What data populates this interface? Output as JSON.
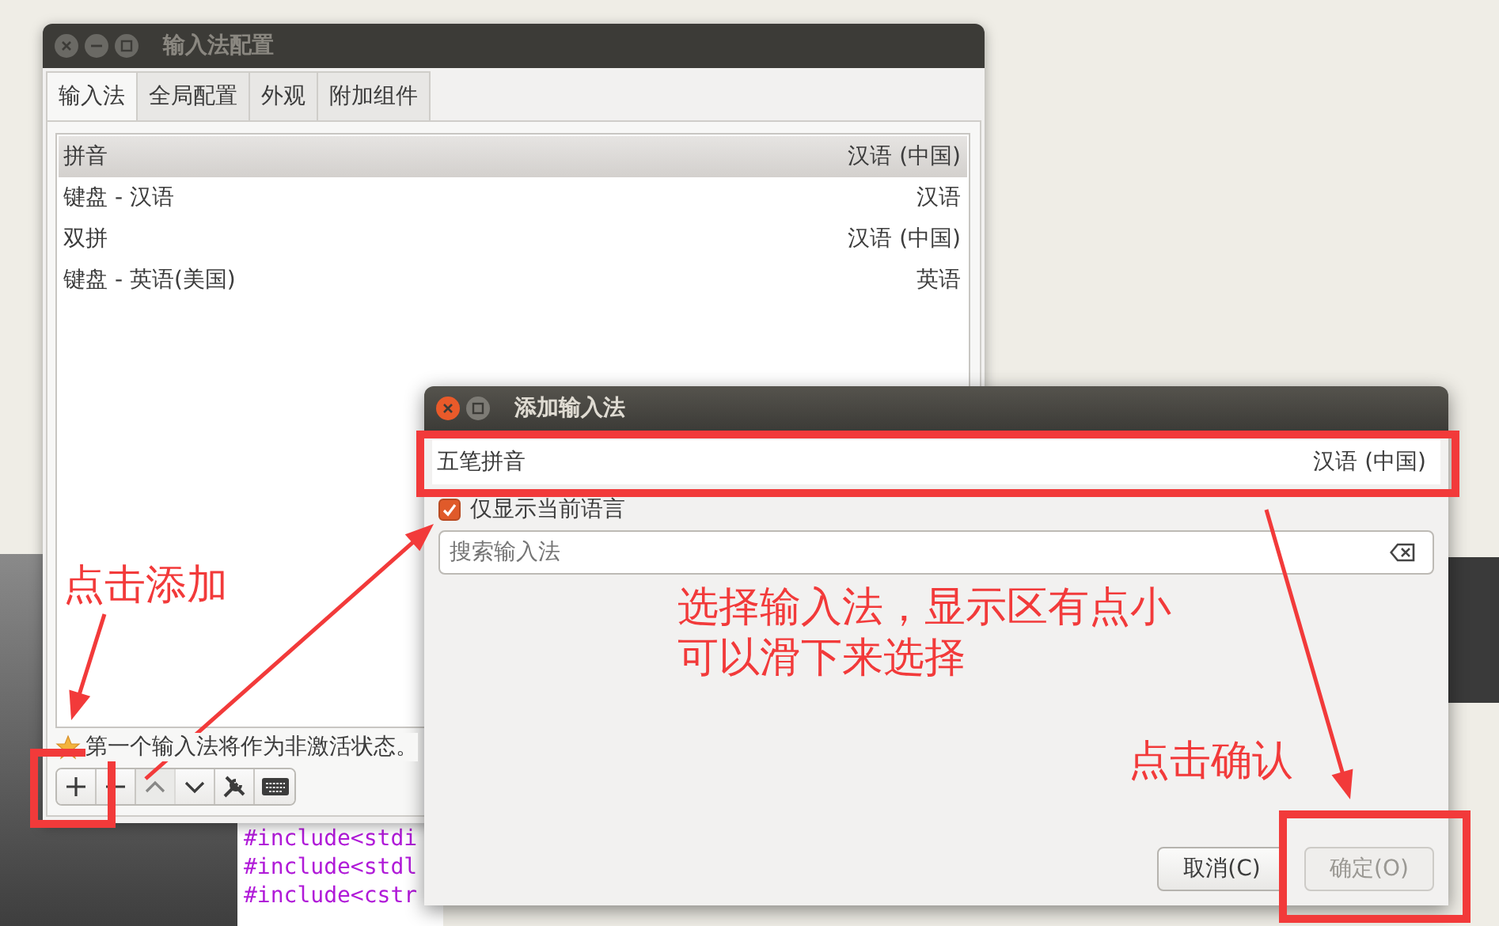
{
  "desktop": {
    "code_lines": [
      "#include<stdi",
      "#include<stdl",
      "#include<cstr"
    ]
  },
  "config_window": {
    "title": "输入法配置",
    "tabs": [
      {
        "label": "输入法",
        "selected": true
      },
      {
        "label": "全局配置",
        "selected": false
      },
      {
        "label": "外观",
        "selected": false
      },
      {
        "label": "附加组件",
        "selected": false
      }
    ],
    "rows": [
      {
        "name": "拼音",
        "language": "汉语 (中国)",
        "selected": true
      },
      {
        "name": "键盘 - 汉语",
        "language": "汉语",
        "selected": false
      },
      {
        "name": "双拼",
        "language": "汉语 (中国)",
        "selected": false
      },
      {
        "name": "键盘 - 英语(美国)",
        "language": "英语",
        "selected": false
      }
    ],
    "note": "第一个输入法将作为非激活状态。",
    "toolbar": [
      {
        "kind": "add",
        "disabled": false
      },
      {
        "kind": "remove",
        "disabled": false
      },
      {
        "kind": "up",
        "disabled": true
      },
      {
        "kind": "down",
        "disabled": false
      },
      {
        "kind": "configure",
        "disabled": false
      },
      {
        "kind": "keyboard",
        "disabled": false
      }
    ]
  },
  "add_dialog": {
    "title": "添加输入法",
    "rows": [
      {
        "name": "五笔拼音",
        "language": "汉语 (中国)",
        "selected": false
      }
    ],
    "only_current_language": {
      "label": "仅显示当前语言",
      "checked": true
    },
    "search": {
      "placeholder": "搜索输入法"
    },
    "buttons": [
      {
        "label": "取消(C)",
        "disabled": false
      },
      {
        "label": "确定(O)",
        "disabled": true
      }
    ]
  },
  "annotations": {
    "add_hint": "点击添加",
    "select_hint": [
      "选择输入法，显示区有点小",
      "可以滑下来选择"
    ],
    "confirm_hint": "点击确认"
  }
}
